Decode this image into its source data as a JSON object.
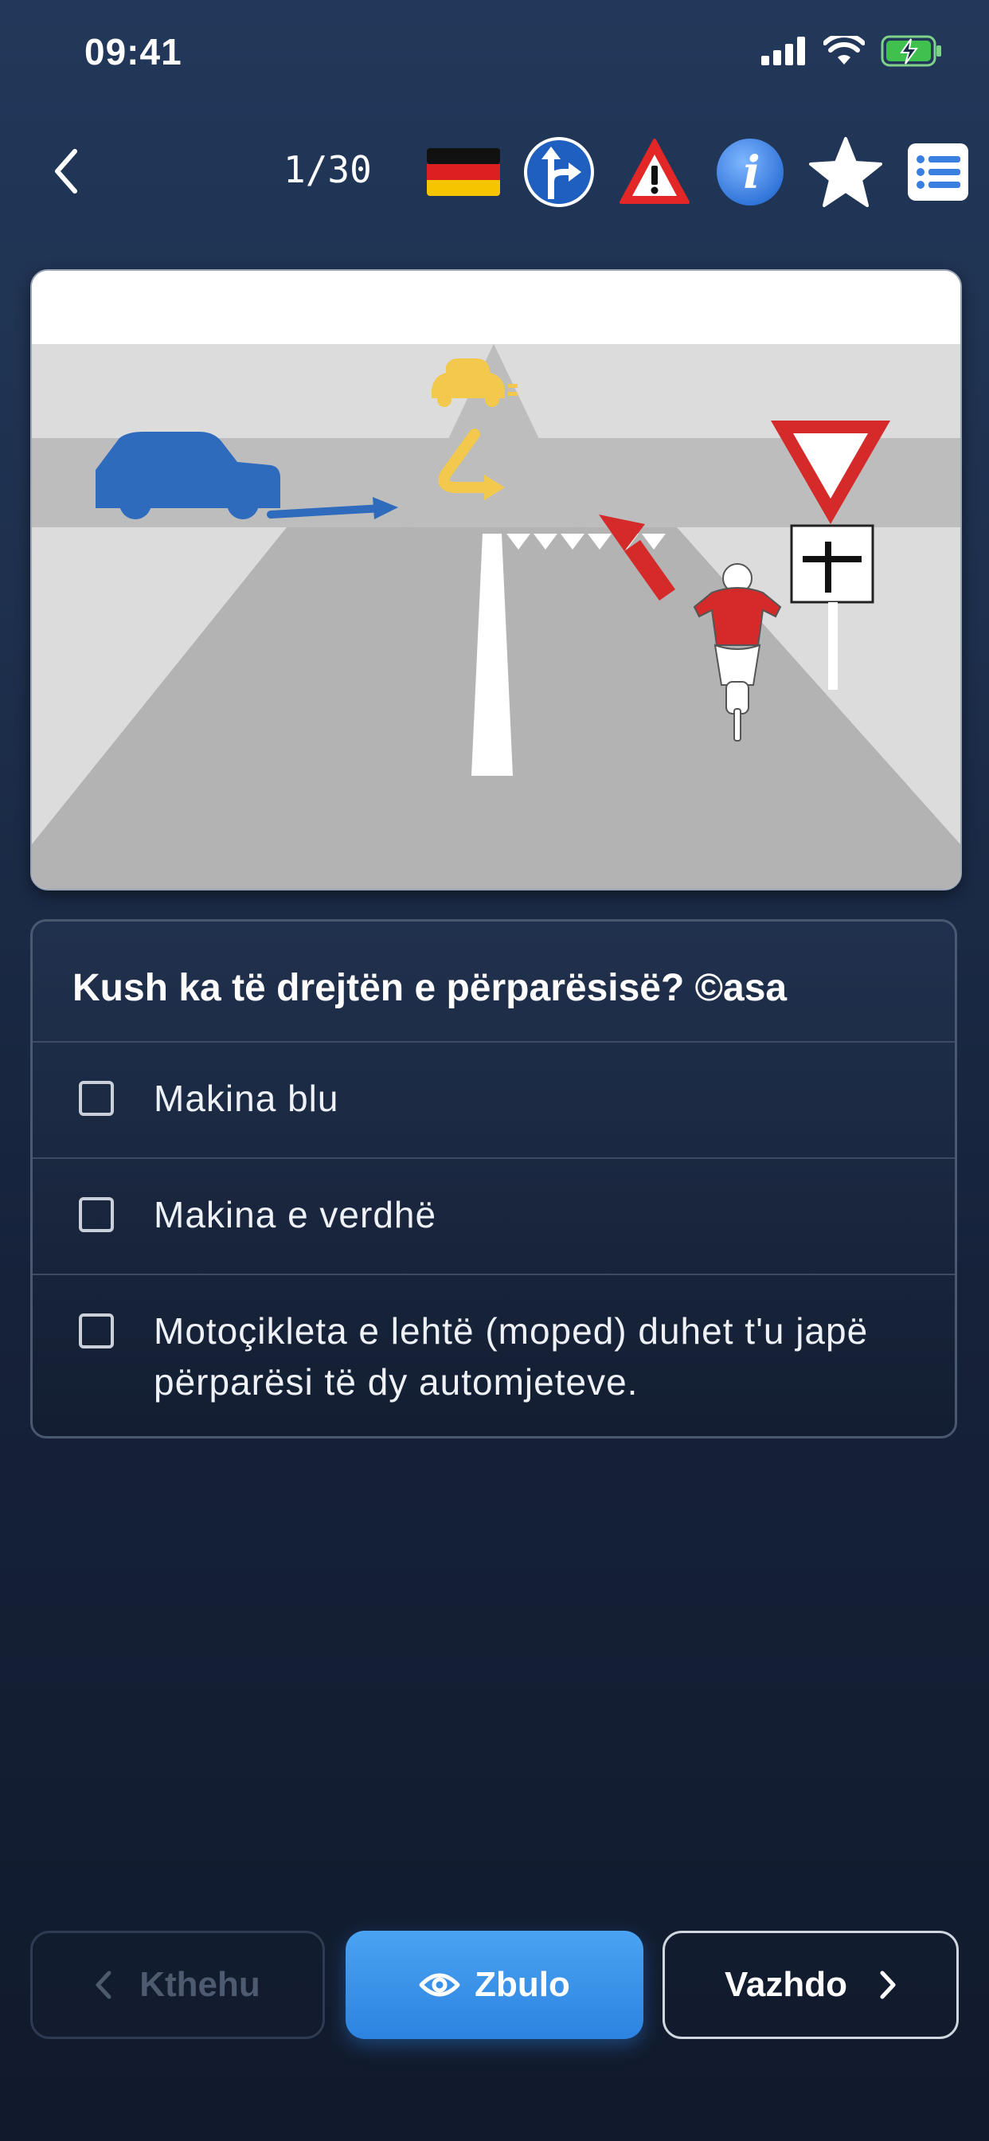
{
  "status_bar": {
    "time": "09:41"
  },
  "header": {
    "counter": "1/30",
    "icons": [
      "back-chevron-icon",
      "germany-flag-icon",
      "direction-sign-icon",
      "warning-sign-icon",
      "info-icon",
      "star-icon",
      "list-icon"
    ]
  },
  "question": {
    "title": "Kush ka të drejtën e përparësisë? ©asa",
    "options": [
      {
        "label": "Makina blu"
      },
      {
        "label": "Makina e verdhë"
      },
      {
        "label": "Motoçikleta e lehtë (moped) duhet t'u japë përparësi të dy automjeteve."
      }
    ]
  },
  "buttons": {
    "back": "Kthehu",
    "reveal": "Zbulo",
    "next": "Vazhdo"
  },
  "colors": {
    "accent": "#2d83e0",
    "blue_car": "#2f6bbd",
    "yellow_car": "#f2c94c",
    "red_arrow": "#d52a2a"
  }
}
